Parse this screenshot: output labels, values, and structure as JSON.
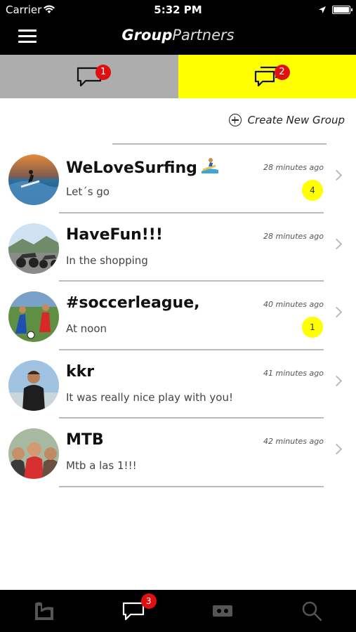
{
  "status_bar": {
    "carrier": "Carrier",
    "time": "5:32 PM"
  },
  "nav": {
    "brand_bold": "Group",
    "brand_light": "Partners",
    "menu_icon": "hamburger-menu-icon"
  },
  "tabs": [
    {
      "icon": "chat-bubble-icon",
      "badge": "1",
      "background": "#adadad"
    },
    {
      "icon": "group-chat-bubbles-icon",
      "badge": "2",
      "background": "#ffff00",
      "active": true
    }
  ],
  "create_group": {
    "label": "Create New Group",
    "icon": "plus-circle-icon"
  },
  "groups": [
    {
      "name": "WeLoveSurfing",
      "emoji": "surfer-emoji",
      "time": "28 minutes ago",
      "message": "Let´s go",
      "unread": "4"
    },
    {
      "name": "HaveFun!!!",
      "time": "28 minutes ago",
      "message": "In the shopping",
      "unread": ""
    },
    {
      "name": "#soccerleague,",
      "time": "40 minutes ago",
      "message": "At noon",
      "unread": "1"
    },
    {
      "name": "kkr",
      "time": "41 minutes ago",
      "message": "It was really nice play with you!",
      "unread": ""
    },
    {
      "name": "MTB",
      "time": "42 minutes ago",
      "message": "Mtb a las 1!!!",
      "unread": ""
    }
  ],
  "bottom_tabs": [
    {
      "icon": "logo-icon"
    },
    {
      "icon": "chat-icon",
      "badge": "3",
      "active": true
    },
    {
      "icon": "ticket-icon"
    },
    {
      "icon": "search-icon"
    }
  ],
  "colors": {
    "accent": "#ffff00",
    "badge": "#e01010",
    "bar": "#000000"
  }
}
